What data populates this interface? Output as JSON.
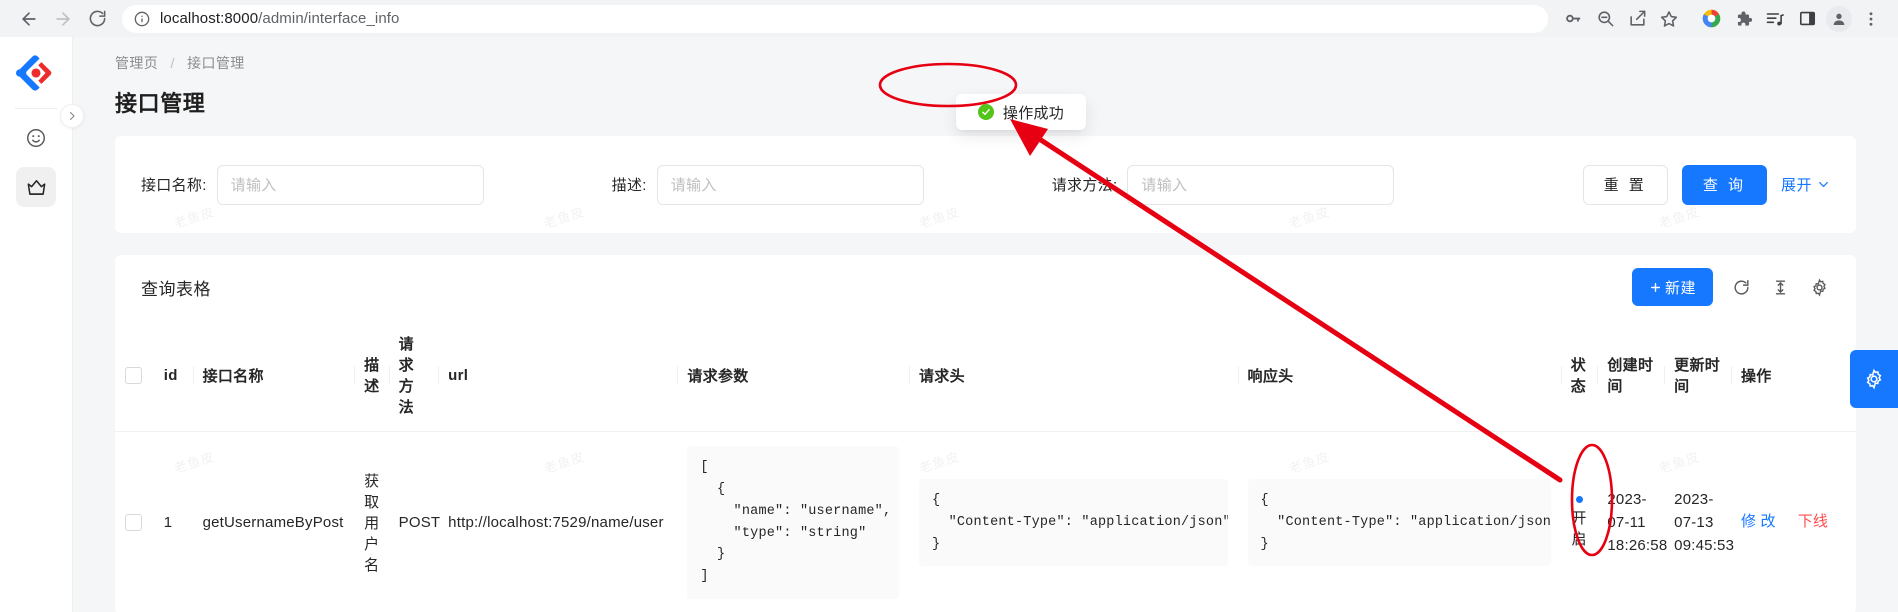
{
  "browser": {
    "url_host": "localhost:8000",
    "url_path": "/admin/interface_info",
    "back_icon": "back-arrow-icon",
    "forward_icon": "forward-arrow-icon",
    "reload_icon": "reload-icon",
    "info_icon": "site-info-icon",
    "toolbar_icons": [
      "password-key-icon",
      "zoom-out-icon",
      "share-icon",
      "bookmark-star-icon",
      "google-colorful-icon",
      "extensions-puzzle-icon",
      "reading-list-icon",
      "side-panel-icon",
      "profile-avatar-icon",
      "chrome-menu-icon"
    ]
  },
  "sidebar": {
    "logo_name": "app-logo",
    "items": [
      {
        "icon": "smiley-face-icon",
        "active": false
      },
      {
        "icon": "crown-icon",
        "active": true
      }
    ],
    "collapse_icon": "chevron-right-icon"
  },
  "header": {
    "breadcrumb": [
      "管理页",
      "接口管理"
    ],
    "separator": "/",
    "title": "接口管理"
  },
  "toast": {
    "message": "操作成功",
    "icon": "success-check-icon",
    "accent": "#52c41a"
  },
  "filter": {
    "fields": [
      {
        "label": "接口名称:",
        "value": "",
        "placeholder": "请输入"
      },
      {
        "label": "描述:",
        "value": "",
        "placeholder": "请输入"
      },
      {
        "label": "请求方法:",
        "value": "",
        "placeholder": "请输入"
      }
    ],
    "reset_label": "重 置",
    "query_label": "查 询",
    "expand_label": "展开",
    "expand_icon": "chevron-down-icon",
    "primary_color": "#1677ff"
  },
  "table_card": {
    "title": "查询表格",
    "new_label": "新建",
    "new_icon": "plus-icon",
    "reload_icon": "refresh-icon",
    "density_icon": "column-height-icon",
    "settings_icon": "gear-icon"
  },
  "table": {
    "columns": [
      "",
      "id",
      "接口名称",
      "描 述",
      "请求 方法",
      "url",
      "请求参数",
      "请求头",
      "响应头",
      "状 态",
      "创建时 间",
      "更新时 间",
      "操作"
    ],
    "rows": [
      {
        "checked": false,
        "id": "1",
        "name": "getUsernameByPost",
        "description": "获 取 用 户 名",
        "method": "POST",
        "url": "http://localhost:7529/name/user",
        "request_params": "[\n  {\n    \"name\": \"username\",\n    \"type\": \"string\"\n  }\n]",
        "request_header": "{\n  \"Content-Type\": \"application/json\"\n}",
        "response_header": "{\n  \"Content-Type\": \"application/json\"\n}",
        "status_label": "开 启",
        "status_color": "#1677ff",
        "create_time": "2023-07-11 18:26:58",
        "update_time": "2023-07-13 09:45:53",
        "actions": [
          {
            "label": "修 改",
            "color": "#1677ff"
          },
          {
            "label": "下线",
            "color": "#ff4d4f"
          }
        ]
      }
    ]
  },
  "float_settings": {
    "icon": "gear-icon",
    "color": "#1677ff"
  },
  "annotations": {
    "toast_circle": "red-ellipse-highlight",
    "status_circle": "red-ellipse-highlight",
    "arrow": "red-arrow-pointing-to-toast",
    "color": "#e60012"
  },
  "watermarks": [
    "老鱼皮",
    "老鱼皮",
    "老鱼皮",
    "老鱼皮",
    "老鱼皮",
    "老鱼皮",
    "老鱼皮",
    "老鱼皮",
    "老鱼皮",
    "老鱼皮"
  ]
}
